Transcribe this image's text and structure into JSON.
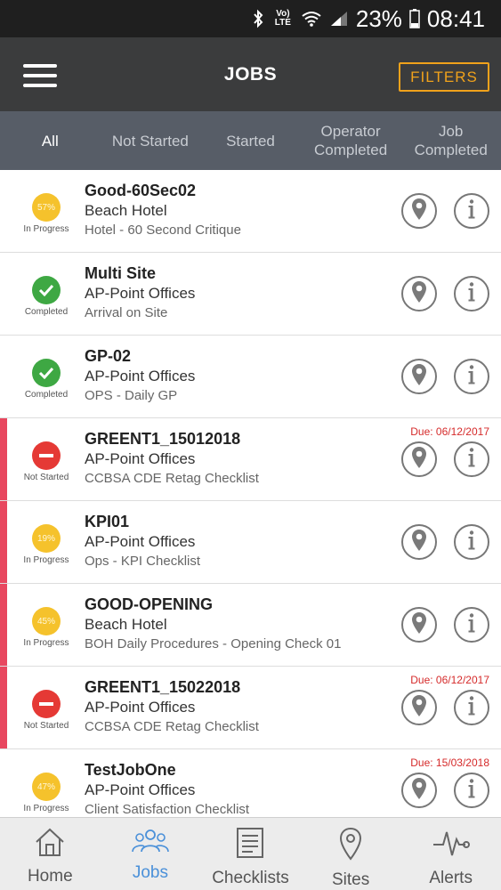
{
  "status_bar": {
    "battery": "23%",
    "time": "08:41",
    "network_top": "Vo)",
    "network_bottom": "LTE"
  },
  "app_bar": {
    "title": "JOBS",
    "filters_label": "FILTERS"
  },
  "tabs": [
    {
      "line1": "All",
      "line2": ""
    },
    {
      "line1": "Not Started",
      "line2": ""
    },
    {
      "line1": "Started",
      "line2": ""
    },
    {
      "line1": "Operator",
      "line2": "Completed"
    },
    {
      "line1": "Job",
      "line2": "Completed"
    }
  ],
  "jobs": [
    {
      "name": "Good-60Sec02",
      "site": "Beach Hotel",
      "checklist": "Hotel - 60 Second Critique",
      "status": "In Progress",
      "percent": "57%",
      "due": ""
    },
    {
      "name": "Multi Site",
      "site": "AP-Point Offices",
      "checklist": "Arrival on Site",
      "status": "Completed",
      "percent": "",
      "due": ""
    },
    {
      "name": "GP-02",
      "site": "AP-Point Offices",
      "checklist": "OPS - Daily GP",
      "status": "Completed",
      "percent": "",
      "due": ""
    },
    {
      "name": "GREENT1_15012018",
      "site": "AP-Point Offices",
      "checklist": "CCBSA CDE Retag Checklist",
      "status": "Not Started",
      "percent": "",
      "due": "Due: 06/12/2017"
    },
    {
      "name": "KPI01",
      "site": "AP-Point Offices",
      "checklist": "Ops - KPI Checklist",
      "status": "In Progress",
      "percent": "19%",
      "due": ""
    },
    {
      "name": "GOOD-OPENING",
      "site": "Beach Hotel",
      "checklist": "BOH Daily Procedures - Opening Check 01",
      "status": "In Progress",
      "percent": "45%",
      "due": ""
    },
    {
      "name": "GREENT1_15022018",
      "site": "AP-Point Offices",
      "checklist": "CCBSA CDE Retag Checklist",
      "status": "Not Started",
      "percent": "",
      "due": "Due: 06/12/2017"
    },
    {
      "name": "TestJobOne",
      "site": "AP-Point Offices",
      "checklist": "Client Satisfaction Checklist",
      "status": "In Progress",
      "percent": "47%",
      "due": "Due: 15/03/2018"
    }
  ],
  "bottom_nav": [
    {
      "label": "Home",
      "icon": "home-icon"
    },
    {
      "label": "Jobs",
      "icon": "people-icon"
    },
    {
      "label": "Checklists",
      "icon": "checklist-icon"
    },
    {
      "label": "Sites",
      "icon": "map-pin-icon"
    },
    {
      "label": "Alerts",
      "icon": "pulse-icon"
    }
  ],
  "colors": {
    "accent": "#f0a21b",
    "progress": "#f5c22c",
    "completed": "#3ea843",
    "not_started": "#e53935",
    "overdue_bar": "#e8475f",
    "nav_active": "#4a90d9"
  }
}
